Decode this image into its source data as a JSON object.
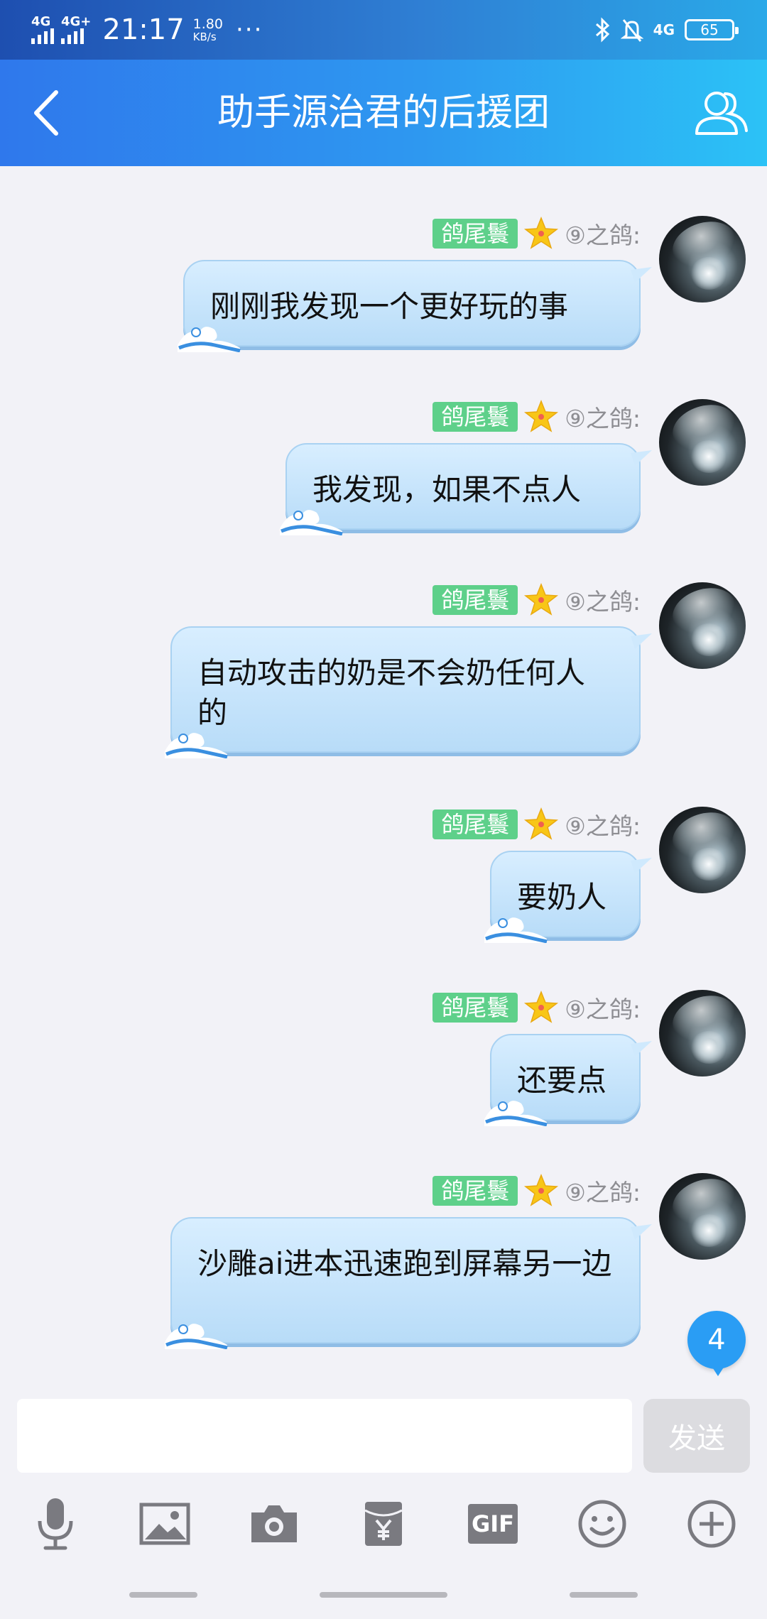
{
  "status_bar": {
    "signal1_label": "4G",
    "signal2_label": "4G+",
    "time": "21:17",
    "speed_value": "1.80",
    "speed_unit": "KB/s",
    "more_dots": "···",
    "net_label": "4G",
    "battery": "65"
  },
  "header": {
    "title": "助手源治君的后援团"
  },
  "messages": [
    {
      "badge": "鸽尾鬟",
      "nick": "⑨之鸽:",
      "text": "刚刚我发现一个更好玩的事"
    },
    {
      "badge": "鸽尾鬟",
      "nick": "⑨之鸽:",
      "text": "我发现，如果不点人"
    },
    {
      "badge": "鸽尾鬟",
      "nick": "⑨之鸽:",
      "text": "自动攻击的奶是不会奶任何人的"
    },
    {
      "badge": "鸽尾鬟",
      "nick": "⑨之鸽:",
      "text": "要奶人"
    },
    {
      "badge": "鸽尾鬟",
      "nick": "⑨之鸽:",
      "text": "还要点"
    },
    {
      "badge": "鸽尾鬟",
      "nick": "⑨之鸽:",
      "text": "沙雕ai进本迅速跑到屏幕另一边"
    }
  ],
  "unread_count": "4",
  "composer": {
    "value": "",
    "send_label": "发送"
  },
  "toolbar": {
    "gif_label": "GIF",
    "icons": [
      "microphone-icon",
      "image-icon",
      "camera-icon",
      "red-packet-icon",
      "gif-icon",
      "emoji-icon",
      "plus-icon"
    ]
  },
  "colors": {
    "header_start": "#2f78ec",
    "header_end": "#2cc2f6",
    "bubble": "#c8e5fb",
    "badge": "#5ed08a",
    "unread": "#2a9df4"
  }
}
